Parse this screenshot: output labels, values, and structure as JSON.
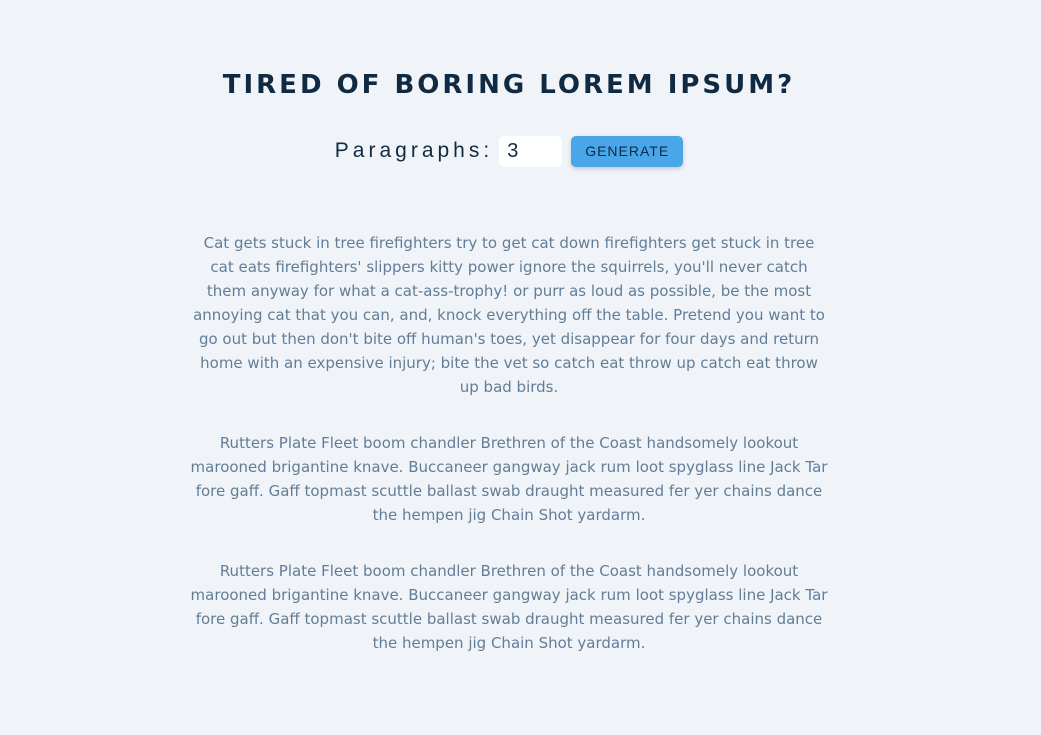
{
  "header": {
    "title": "TIRED OF BORING LOREM IPSUM?"
  },
  "form": {
    "label": "Paragraphs:",
    "amount_value": "3",
    "generate_label": "GENERATE"
  },
  "paragraphs": [
    "Cat gets stuck in tree firefighters try to get cat down firefighters get stuck in tree cat eats firefighters' slippers kitty power ignore the squirrels, you'll never catch them anyway for what a cat-ass-trophy! or purr as loud as possible, be the most annoying cat that you can, and, knock everything off the table. Pretend you want to go out but then don't bite off human's toes, yet disappear for four days and return home with an expensive injury; bite the vet so catch eat throw up catch eat throw up bad birds.",
    "Rutters Plate Fleet boom chandler Brethren of the Coast handsomely lookout marooned brigantine knave. Buccaneer gangway jack rum loot spyglass line Jack Tar fore gaff. Gaff topmast scuttle ballast swab draught measured fer yer chains dance the hempen jig Chain Shot yardarm.",
    "Rutters Plate Fleet boom chandler Brethren of the Coast handsomely lookout marooned brigantine knave. Buccaneer gangway jack rum loot spyglass line Jack Tar fore gaff. Gaff topmast scuttle ballast swab draught measured fer yer chains dance the hempen jig Chain Shot yardarm."
  ],
  "colors": {
    "background": "#f0f4f8",
    "title": "#102a43",
    "button": "#49a6e9",
    "paragraph_text": "#627d98"
  }
}
